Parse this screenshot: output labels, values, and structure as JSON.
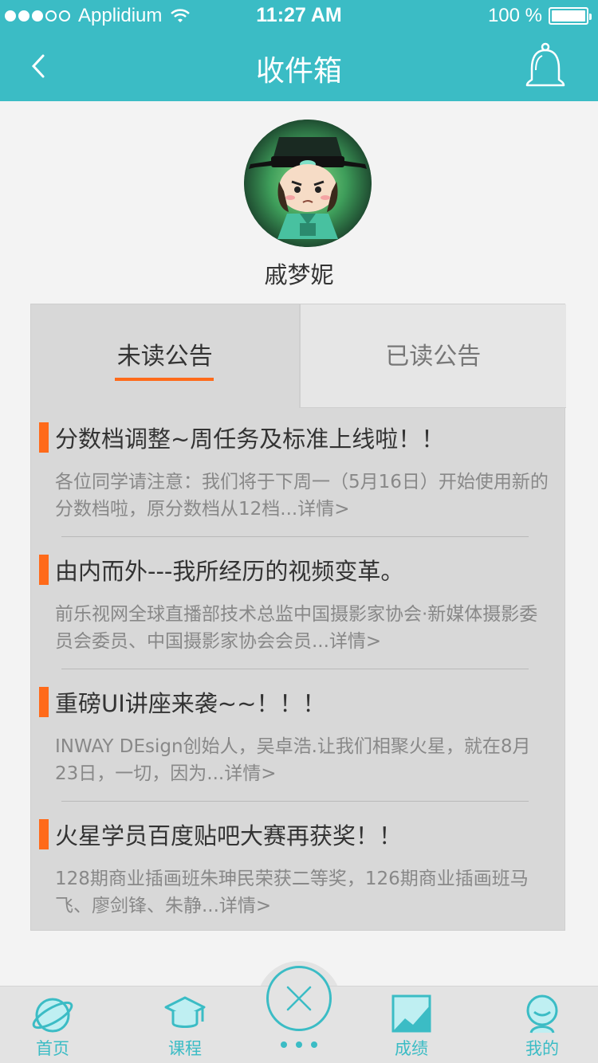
{
  "status_bar": {
    "carrier": "Applidium",
    "time": "11:27 AM",
    "battery": "100 %"
  },
  "nav": {
    "title": "收件箱",
    "back_icon": "chevron-left-icon",
    "bell_icon": "bell-icon"
  },
  "profile": {
    "name": "戚梦妮"
  },
  "tabs": [
    {
      "label": "未读公告",
      "active": true
    },
    {
      "label": "已读公告",
      "active": false
    }
  ],
  "announcements": [
    {
      "title": "分数档调整~周任务及标准上线啦！！",
      "summary": "各位同学请注意：我们将于下周一（5月16日）开始使用新的分数档啦，原分数档从12档...详情>"
    },
    {
      "title": "由内而外---我所经历的视频变革。",
      "summary": "前乐视网全球直播部技术总监中国摄影家协会·新媒体摄影委员会委员、中国摄影家协会会员...详情>"
    },
    {
      "title": "重磅UI讲座来袭~~！！！",
      "summary": "INWAY DEsign创始人，吴卓浩.让我们相聚火星，就在8月23日，一切，因为...详情>"
    },
    {
      "title": "火星学员百度贴吧大赛再获奖！！",
      "summary": "128期商业插画班朱珅民荣获二等奖，126期商业插画班马飞、廖剑锋、朱静...详情>"
    }
  ],
  "tabbar": {
    "items": [
      {
        "label": "首页",
        "icon": "planet-icon"
      },
      {
        "label": "课程",
        "icon": "graduation-cap-icon"
      },
      {
        "label": "成绩",
        "icon": "chart-icon"
      },
      {
        "label": "我的",
        "icon": "user-icon"
      }
    ],
    "center_icon": "close-icon"
  },
  "colors": {
    "accent": "#3bbcc5",
    "highlight": "#ff6a1a"
  }
}
